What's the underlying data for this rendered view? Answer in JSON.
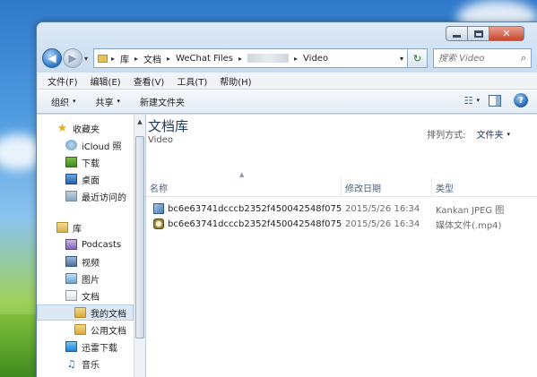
{
  "window": {
    "caption": {
      "minimize": "",
      "maximize": "",
      "close": "✕"
    }
  },
  "nav": {
    "back": "◀",
    "forward": "▶",
    "history": "▾",
    "breadcrumb": [
      "库",
      "文档",
      "WeChat Files",
      "Video"
    ],
    "crumb_sep": "▸",
    "address_dropdown": "▾",
    "refresh": "↻",
    "search_placeholder": "搜索 Video",
    "search_icon": "⌕"
  },
  "menubar": [
    "文件(F)",
    "编辑(E)",
    "查看(V)",
    "工具(T)",
    "帮助(H)"
  ],
  "toolbar": {
    "organize": "组织",
    "share": "共享",
    "new_folder": "新建文件夹",
    "caret": "▾",
    "view_icon": "☷",
    "help": "?"
  },
  "sidebar": {
    "items": [
      {
        "label": "收藏夹",
        "icon": "star",
        "glyph": "★"
      },
      {
        "label": "iCloud 照",
        "icon": "icloud",
        "glyph": ""
      },
      {
        "label": "下载",
        "icon": "download",
        "glyph": ""
      },
      {
        "label": "桌面",
        "icon": "desktop",
        "glyph": ""
      },
      {
        "label": "最近访问的",
        "icon": "recent",
        "glyph": ""
      },
      {
        "label": "库",
        "icon": "library",
        "glyph": ""
      },
      {
        "label": "Podcasts",
        "icon": "podcast",
        "glyph": ""
      },
      {
        "label": "视频",
        "icon": "video",
        "glyph": ""
      },
      {
        "label": "图片",
        "icon": "picture",
        "glyph": ""
      },
      {
        "label": "文档",
        "icon": "document",
        "glyph": ""
      },
      {
        "label": "我的文档",
        "icon": "folder",
        "glyph": ""
      },
      {
        "label": "公用文档",
        "icon": "folder",
        "glyph": ""
      },
      {
        "label": "迅雷下载",
        "icon": "thunder",
        "glyph": ""
      },
      {
        "label": "音乐",
        "icon": "music",
        "glyph": "♫"
      }
    ],
    "scroll_up": "▲"
  },
  "content": {
    "library_title": "文档库",
    "library_subtitle": "Video",
    "arrange_label": "排列方式:",
    "arrange_value": "文件夹",
    "sort_caret": "▲",
    "columns": {
      "name": "名称",
      "date": "修改日期",
      "type": "类型"
    },
    "files": [
      {
        "name": "bc6e63741dcccb2352f450042548f075",
        "date": "2015/5/26 16:34",
        "type": "Kankan JPEG 图",
        "icon": "image-file"
      },
      {
        "name": "bc6e63741dcccb2352f450042548f075",
        "date": "2015/5/26 16:34",
        "type": "媒体文件(.mp4)",
        "icon": "media-file"
      }
    ]
  }
}
